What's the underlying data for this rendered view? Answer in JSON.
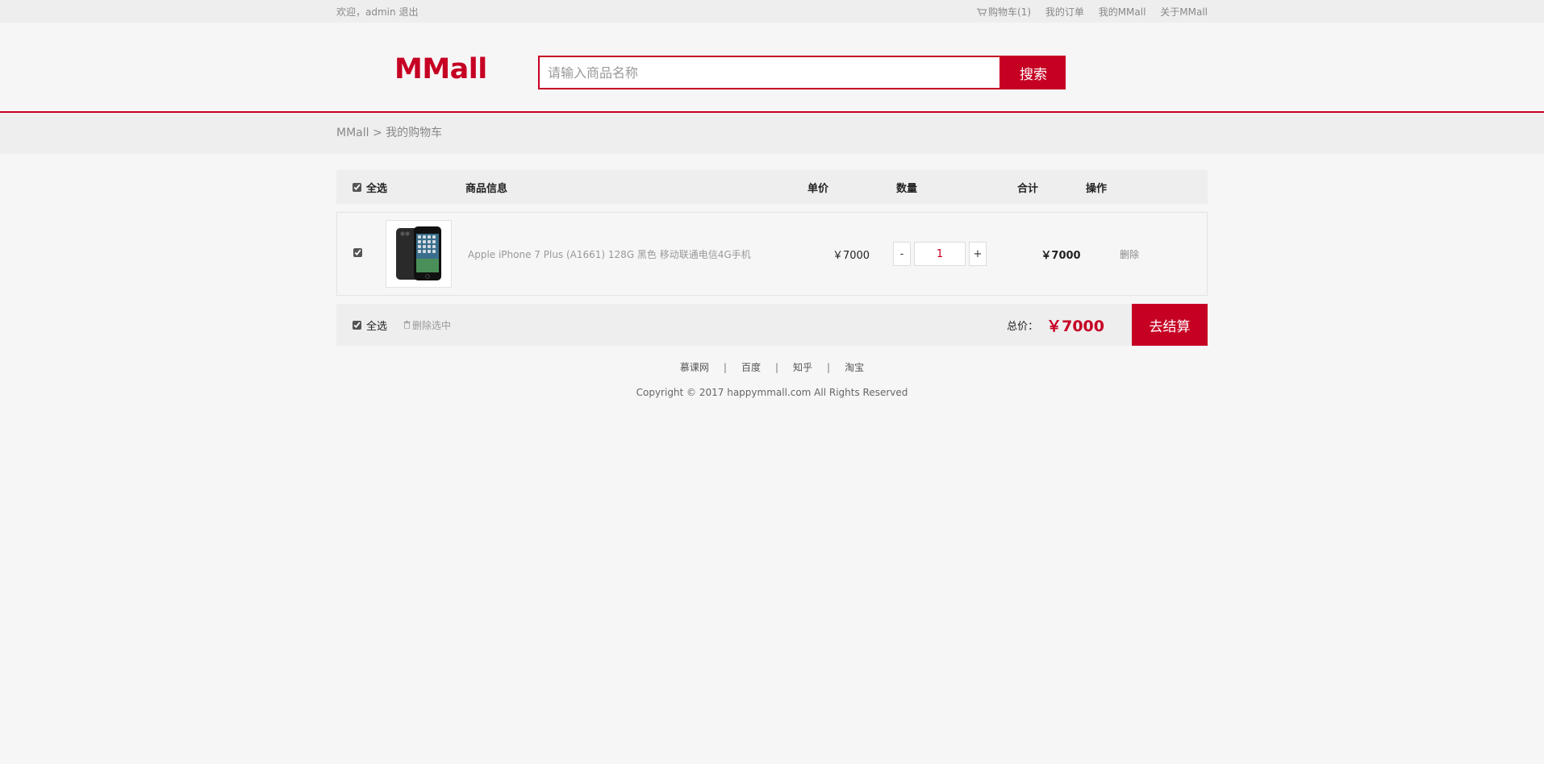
{
  "topnav": {
    "welcome": "欢迎，admin",
    "logout": "退出",
    "cart": "购物车(1)",
    "orders": "我的订单",
    "my_mmall": "我的MMall",
    "about": "关于MMall"
  },
  "header": {
    "logo": "MMall",
    "search_placeholder": "请输入商品名称",
    "search_button": "搜索"
  },
  "breadcrumb": {
    "home": "MMall",
    "separator": ">",
    "current": "我的购物车"
  },
  "cart": {
    "head": {
      "select_all": "全选",
      "info": "商品信息",
      "price": "单价",
      "count": "数量",
      "total": "合计",
      "op": "操作"
    },
    "items": [
      {
        "name": "Apple iPhone 7 Plus (A1661) 128G 黑色 移动联通电信4G手机",
        "price": "￥7000",
        "quantity": "1",
        "minus": "-",
        "plus": "+",
        "total": "￥7000",
        "delete": "删除",
        "checked": true
      }
    ],
    "foot": {
      "select_all": "全选",
      "delete_selected": "删除选中",
      "total_label": "总价：",
      "total_amount": "￥7000",
      "submit": "去结算"
    }
  },
  "footer": {
    "links": [
      "慕课网",
      "百度",
      "知乎",
      "淘宝"
    ],
    "separator": "|",
    "copyright": "Copyright © 2017 happymmall.com All Rights Reserved"
  },
  "colors": {
    "brand": "#c60023",
    "background": "#f6f6f6",
    "bar": "#eeeeee"
  }
}
